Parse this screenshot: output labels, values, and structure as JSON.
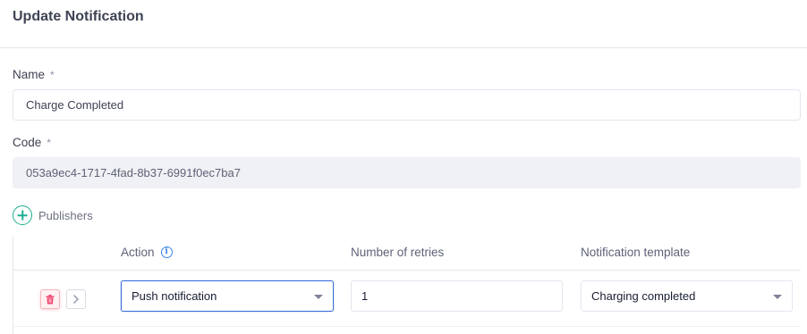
{
  "header": {
    "title": "Update Notification"
  },
  "form": {
    "name": {
      "label": "Name",
      "required_mark": "*",
      "value": "Charge Completed"
    },
    "code": {
      "label": "Code",
      "required_mark": "*",
      "value": "053a9ec4-1717-4fad-8b37-6991f0ec7ba7"
    }
  },
  "publishers": {
    "add_label": "Publishers",
    "columns": {
      "action": "Action",
      "retries": "Number of retries",
      "template": "Notification template"
    },
    "rows": [
      {
        "action": "Push notification",
        "retries": "1",
        "template": "Charging completed"
      }
    ]
  },
  "icons": {
    "add": "plus-circle-icon",
    "info": "info-icon",
    "delete": "trash-icon",
    "expand": "chevron-right-icon"
  },
  "colors": {
    "accent_green": "#1bae8f",
    "info_blue": "#3a86e8",
    "danger_red": "#f1416c",
    "focus_blue": "#3a6fd8"
  }
}
